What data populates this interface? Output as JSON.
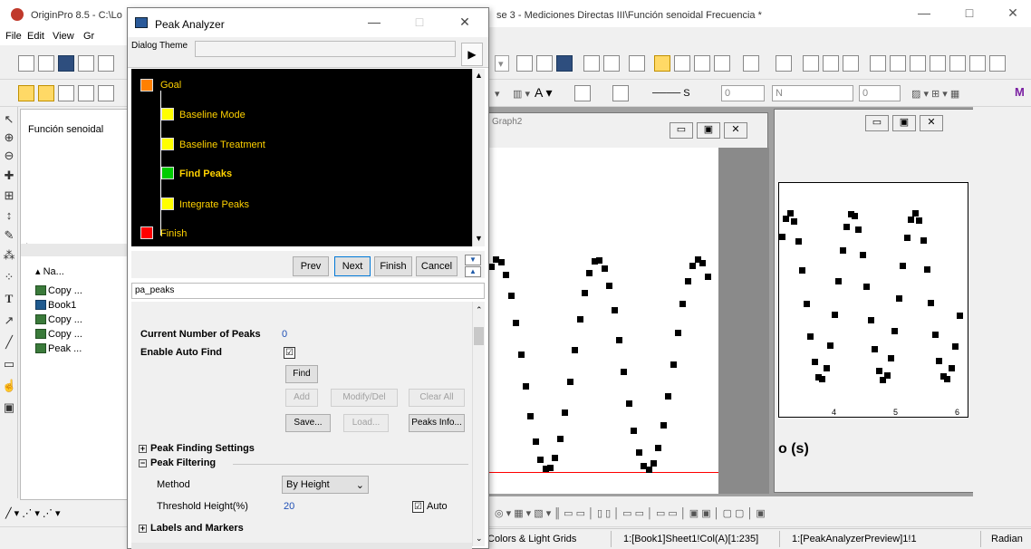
{
  "app": {
    "title_left": "OriginPro 8.5 - C:\\Lo",
    "title_right": "se 3 - Mediciones Directas III\\Función senoidal Frecuencia *",
    "menu": [
      "File",
      "Edit",
      "View",
      "Gr"
    ],
    "min_glyph": "—",
    "max_glyph": "□",
    "close_glyph": "✕"
  },
  "toolbars": {
    "format_fields": [
      "0",
      "N",
      "0"
    ],
    "line_label": "S",
    "bold_label": "M"
  },
  "explorer": {
    "folder": "Función senoidal",
    "column_header": "Na...",
    "items": [
      {
        "label": "Copy ...",
        "kind": "graph"
      },
      {
        "label": "Book1",
        "kind": "workbook"
      },
      {
        "label": "Copy ...",
        "kind": "graph"
      },
      {
        "label": "Copy ...",
        "kind": "graph"
      },
      {
        "label": "Peak ...",
        "kind": "graph"
      }
    ]
  },
  "mdi": {
    "graph_title": "Graph2",
    "xaxis_fragment": "o (s)",
    "ticks": [
      "4",
      "5",
      "6"
    ]
  },
  "dialog": {
    "title": "Peak Analyzer",
    "theme_label": "Dialog Theme",
    "theme_arrow": "▶",
    "tree": [
      {
        "label": "Goal",
        "color": "#ff8000",
        "bold": false
      },
      {
        "label": "Baseline Mode",
        "color": "#ffff00",
        "bold": false
      },
      {
        "label": "Baseline Treatment",
        "color": "#ffff00",
        "bold": false
      },
      {
        "label": "Find Peaks",
        "color": "#00cc00",
        "bold": true
      },
      {
        "label": "Integrate Peaks",
        "color": "#ffff00",
        "bold": false
      },
      {
        "label": "Finish",
        "color": "#ff0000",
        "bold": false
      }
    ],
    "nav": {
      "prev": "Prev",
      "next": "Next",
      "finish": "Finish",
      "cancel": "Cancel"
    },
    "page_name": "pa_peaks",
    "panel": {
      "current_peaks_label": "Current Number of Peaks",
      "current_peaks_value": "0",
      "auto_find_label": "Enable Auto Find",
      "auto_find_checked": "☑",
      "find": "Find",
      "add": "Add",
      "modify_del": "Modify/Del",
      "clear_all": "Clear All",
      "save": "Save...",
      "load": "Load...",
      "peaks_info": "Peaks Info...",
      "peak_finding_settings": "Peak Finding Settings",
      "peak_filtering": "Peak Filtering",
      "method_label": "Method",
      "method_value": "By Height",
      "threshold_label": "Threshold Height(%)",
      "threshold_value": "20",
      "auto_label": "Auto",
      "labels_markers": "Labels and Markers"
    }
  },
  "status": {
    "grids": "Colors & Light Grids",
    "column": "1:[Book1]Sheet1!Col(A)[1:235]",
    "preview": "1:[PeakAnalyzerPreview]1!1",
    "units": "Radian"
  },
  "colors": {
    "accent": "#0078d7",
    "tree_bg": "#000000",
    "tree_text": "#ffd200",
    "baseline": "#ff0000"
  }
}
